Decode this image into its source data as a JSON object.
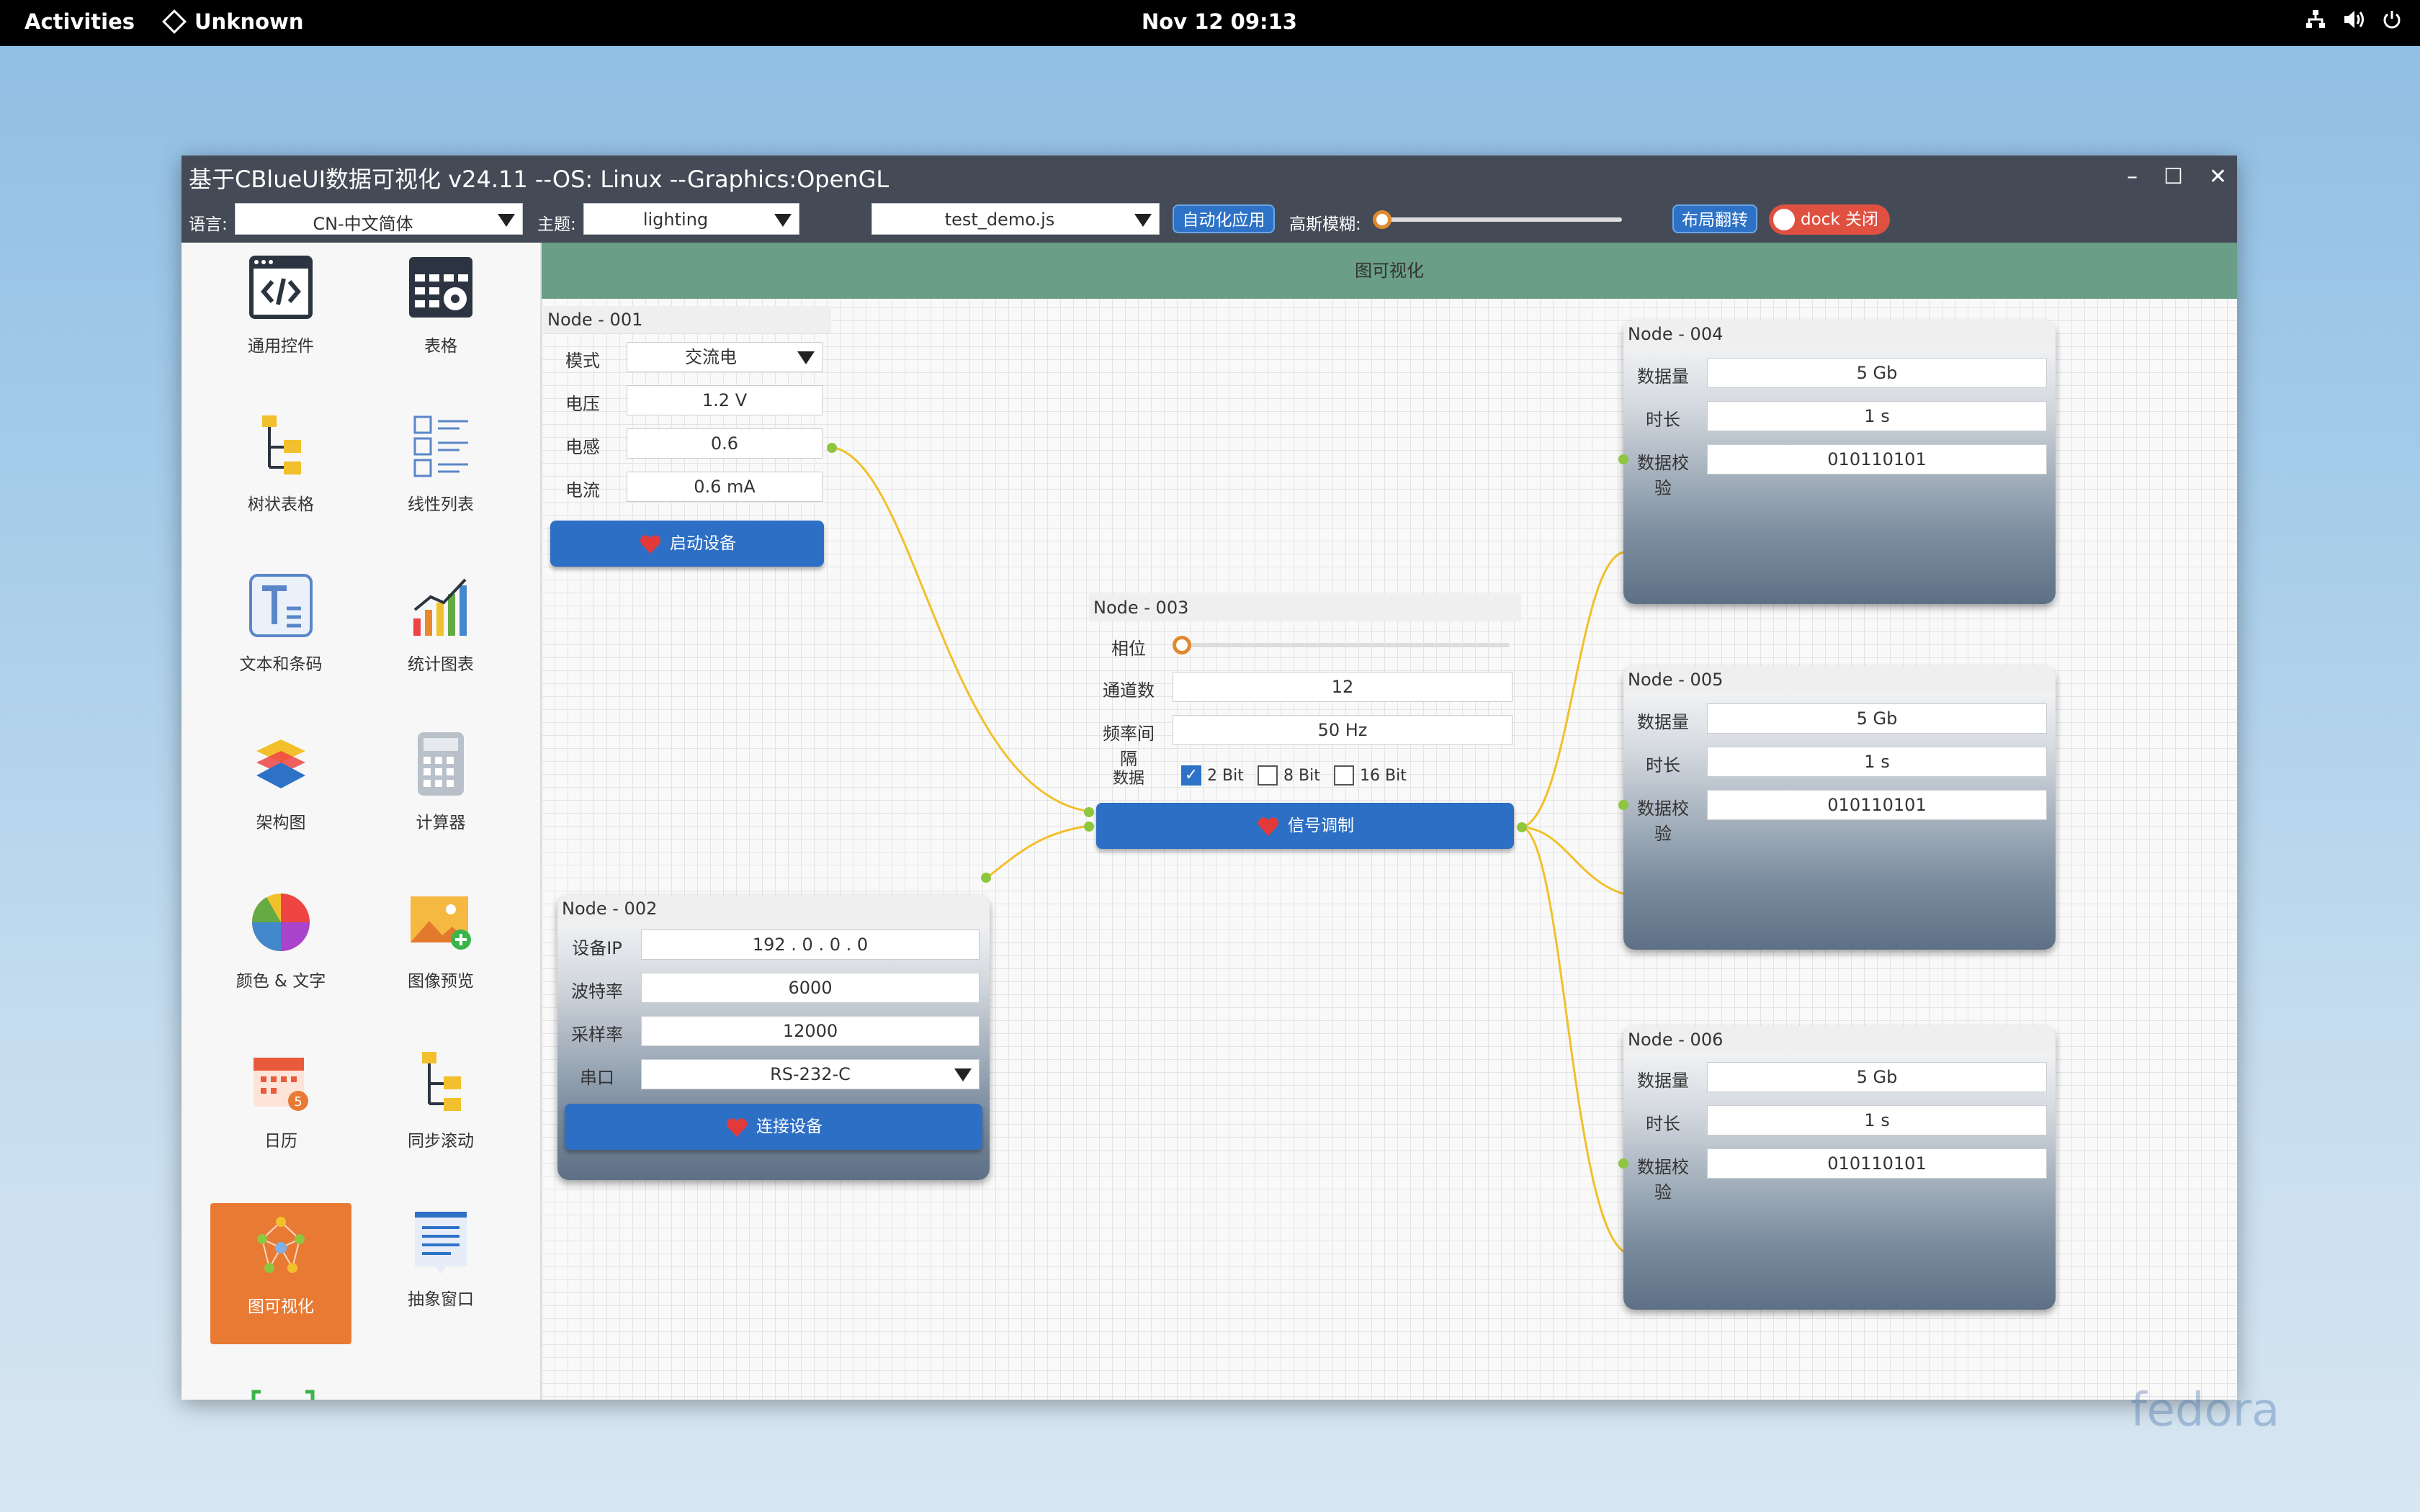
{
  "topbar": {
    "activities": "Activities",
    "app_name": "Unknown",
    "clock": "Nov 12  09:13"
  },
  "window": {
    "title": "基于CBlueUI数据可视化  v24.11  --OS: Linux  --Graphics:OpenGL",
    "minimize": "–",
    "maximize": "☐",
    "close": "✕"
  },
  "toolbar": {
    "lang_label": "语言:",
    "lang_value": "CN-中文简体",
    "theme_label": "主题:",
    "theme_value": "lighting",
    "file_value": "test_demo.js",
    "auto_btn": "自动化应用",
    "blur_label": "高斯模糊:",
    "blur_level": 0.0,
    "layout_btn": "布局翻转",
    "dock_btn": "dock 关闭"
  },
  "sidebar": {
    "items": [
      {
        "label": "通用控件",
        "icon": "code-window-icon"
      },
      {
        "label": "表格",
        "icon": "table-gear-icon"
      },
      {
        "label": "树状表格",
        "icon": "tree-table-icon"
      },
      {
        "label": "线性列表",
        "icon": "linear-list-icon"
      },
      {
        "label": "文本和条码",
        "icon": "text-icon"
      },
      {
        "label": "统计图表",
        "icon": "bar-chart-icon"
      },
      {
        "label": "架构图",
        "icon": "layers-icon"
      },
      {
        "label": "计算器",
        "icon": "calculator-icon"
      },
      {
        "label": "颜色 & 文字",
        "icon": "color-wheel-icon"
      },
      {
        "label": "图像预览",
        "icon": "image-preview-icon"
      },
      {
        "label": "日历",
        "icon": "calendar-icon"
      },
      {
        "label": "同步滚动",
        "icon": "sync-scroll-icon"
      },
      {
        "label": "图可视化",
        "icon": "graph-visualization-icon",
        "active": true
      },
      {
        "label": "抽象窗口",
        "icon": "abstract-window-icon"
      }
    ]
  },
  "canvas": {
    "header": "图可视化"
  },
  "nodes": {
    "n001": {
      "title": "Node - 001",
      "rows": [
        {
          "label": "模式",
          "value": "交流电"
        },
        {
          "label": "电压",
          "value": "1.2 V"
        },
        {
          "label": "电感",
          "value": "0.6"
        },
        {
          "label": "电流",
          "value": "0.6 mA"
        }
      ],
      "button": "启动设备"
    },
    "n002": {
      "title": "Node - 002",
      "rows": [
        {
          "label": "设备IP",
          "value": "192 . 0 . 0 . 0"
        },
        {
          "label": "波特率",
          "value": "6000"
        },
        {
          "label": "采样率",
          "value": "12000"
        },
        {
          "label": "串口",
          "value": "RS-232-C"
        }
      ],
      "button": "连接设备"
    },
    "n003": {
      "title": "Node - 003",
      "phase_label": "相位",
      "phase_level": 0.0,
      "rows": [
        {
          "label": "通道数",
          "value": "12"
        },
        {
          "label": "频率间隔",
          "value": "50 Hz"
        }
      ],
      "data_label": "数据",
      "checks": [
        {
          "label": "2 Bit",
          "checked": true
        },
        {
          "label": "8 Bit",
          "checked": false
        },
        {
          "label": "16 Bit",
          "checked": false
        }
      ],
      "button": "信号调制"
    },
    "n004": {
      "title": "Node - 004",
      "rows": [
        {
          "label": "数据量",
          "value": "5 Gb"
        },
        {
          "label": "时长",
          "value": "1 s"
        },
        {
          "label": "数据校验",
          "value": "010110101"
        }
      ]
    },
    "n005": {
      "title": "Node - 005",
      "rows": [
        {
          "label": "数据量",
          "value": "5 Gb"
        },
        {
          "label": "时长",
          "value": "1 s"
        },
        {
          "label": "数据校验",
          "value": "010110101"
        }
      ]
    },
    "n006": {
      "title": "Node - 006",
      "rows": [
        {
          "label": "数据量",
          "value": "5 Gb"
        },
        {
          "label": "时长",
          "value": "1 s"
        },
        {
          "label": "数据校验",
          "value": "010110101"
        }
      ]
    }
  },
  "colors": {
    "accent": "#2d72c7",
    "header_green": "#6a9e86",
    "active_orange": "#e87a34",
    "link_yellow": "#f2c02c",
    "port_green": "#8ec63f"
  },
  "desktop": {
    "watermark": "fedora"
  }
}
